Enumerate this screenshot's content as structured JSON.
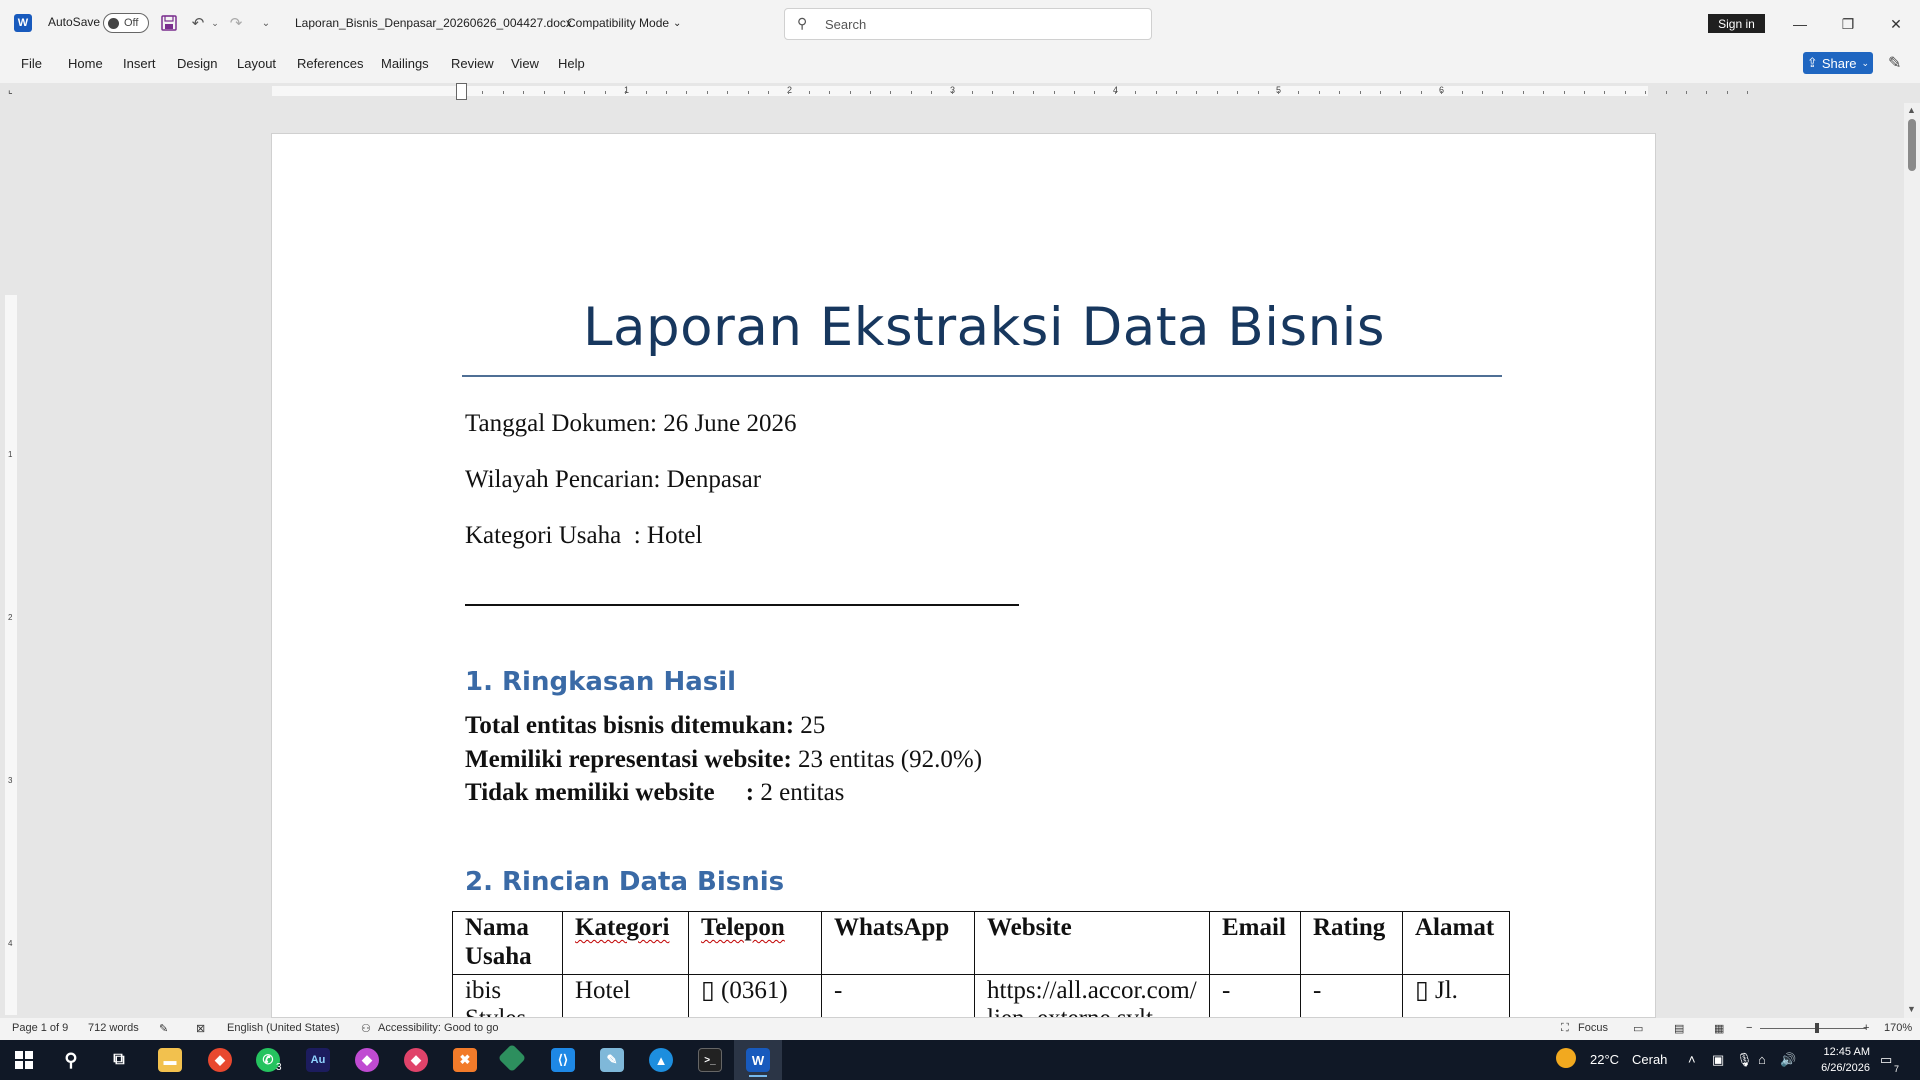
{
  "window": {
    "autosave_label": "AutoSave",
    "autosave_state": "Off",
    "doc_title": "Laporan_Bisnis_Denpasar_20260626_004427.docx",
    "doc_mode": "Compatibility Mode",
    "search_placeholder": "Search",
    "signin_label": "Sign in"
  },
  "ribbon": {
    "tabs": [
      "File",
      "Home",
      "Insert",
      "Design",
      "Layout",
      "References",
      "Mailings",
      "Review",
      "View",
      "Help"
    ],
    "share_label": "Share"
  },
  "ruler": {
    "numbers": [
      "1",
      "2",
      "3",
      "4",
      "5",
      "6"
    ],
    "vnumbers": [
      "1",
      "2",
      "3",
      "4"
    ]
  },
  "document": {
    "title": "Laporan Ekstraksi Data Bisnis",
    "tanggal": "Tanggal Dokumen: 26 June 2026",
    "wilayah": "Wilayah Pencarian: Denpasar",
    "kategori": "Kategori Usaha  : Hotel",
    "section1_title": "1. Ringkasan Hasil",
    "summary": {
      "total_label": "Total entitas bisnis ditemukan:",
      "total_value": " 25",
      "website_label": "Memiliki representasi website:",
      "website_value": " 23 entitas (92.0%)",
      "nowebsite_label": "Tidak memiliki website     :",
      "nowebsite_value": " 2 entitas"
    },
    "section2_title": "2. Rincian Data Bisnis",
    "table": {
      "headers": [
        "Nama Usaha",
        "Kategori",
        "Telepon",
        "WhatsApp",
        "Website",
        "Email",
        "Rating",
        "Alamat"
      ],
      "row1": [
        "ibis Styles",
        "Hotel",
        "▯ (0361)",
        "-",
        "https://all.accor.com/lien_externe.svlt",
        "-",
        "-",
        "▯ Jl."
      ]
    }
  },
  "statusbar": {
    "page": "Page 1 of 9",
    "words": "712 words",
    "language": "English (United States)",
    "accessibility": "Accessibility: Good to go",
    "focus": "Focus",
    "zoom": "170%"
  },
  "taskbar": {
    "weather_temp": "22°C",
    "weather_text": "Cerah",
    "time": "12:45 AM",
    "date": "6/26/2026",
    "whatsapp_badge": "3",
    "notif_badge": "7"
  },
  "colors": {
    "heading": "#17375e",
    "section_heading": "#3a6aa6",
    "share_button": "#1f66c1",
    "taskbar": "#101826"
  }
}
